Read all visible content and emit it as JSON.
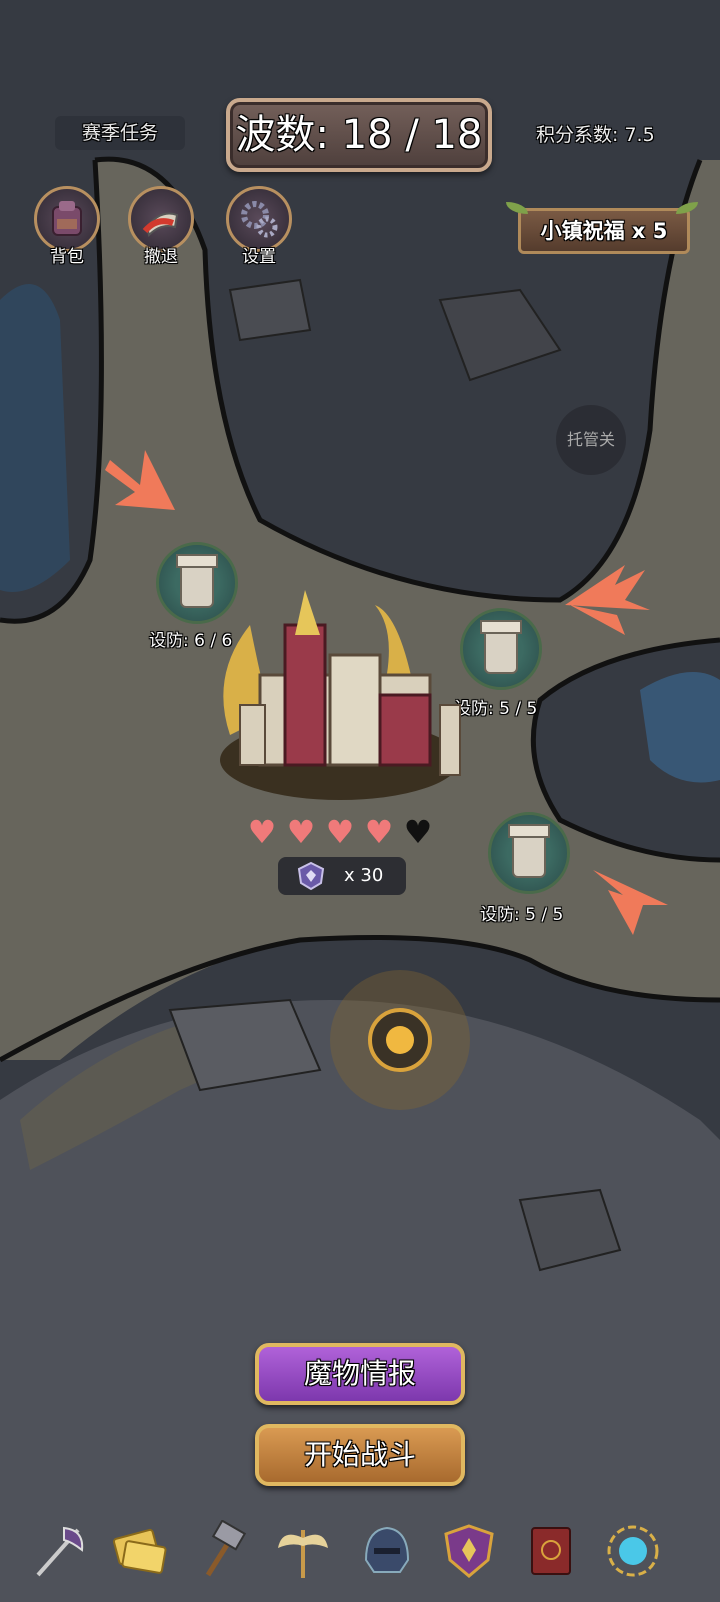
{
  "hud": {
    "season_task": "赛季任务",
    "wave_label": "波数: 18 / 18",
    "score_multiplier": "积分系数: 7.5",
    "town_blessing": "小镇祝福 x 5",
    "auto_toggle": "托管关"
  },
  "top_buttons": [
    {
      "label": "背包",
      "icon": "backpack-icon"
    },
    {
      "label": "撤退",
      "icon": "retreat-flag-icon"
    },
    {
      "label": "设置",
      "icon": "gears-icon"
    }
  ],
  "towers": [
    {
      "defense": "设防: 6 / 6"
    },
    {
      "defense": "设防: 5 / 5"
    },
    {
      "defense": "设防: 5 / 5"
    }
  ],
  "castle": {
    "hearts_total": 5,
    "hearts_filled": 4,
    "medal_count": "x 30"
  },
  "actions": {
    "monster_info": "魔物情报",
    "start_battle": "开始战斗"
  },
  "bottom_bar": [
    {
      "icon": "battle-axe-icon"
    },
    {
      "icon": "tickets-icon"
    },
    {
      "icon": "hammer-icon"
    },
    {
      "icon": "winged-staff-icon"
    },
    {
      "icon": "helmet-icon"
    },
    {
      "icon": "shield-icon"
    },
    {
      "icon": "spellbook-icon"
    },
    {
      "icon": "portal-orb-icon"
    }
  ],
  "colors": {
    "monster_button": "#9a4fc8",
    "battle_button": "#c98845",
    "heart": "#f07a7a",
    "arrow": "#f07a5a"
  }
}
